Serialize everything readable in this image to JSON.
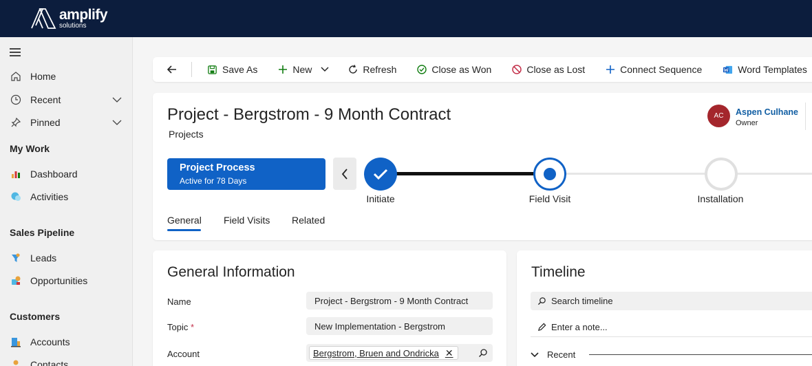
{
  "brand": {
    "name": "amplify",
    "tagline": "solutions"
  },
  "sidebar": {
    "items": [
      {
        "label": "Home"
      },
      {
        "label": "Recent"
      },
      {
        "label": "Pinned"
      }
    ],
    "sections": [
      {
        "title": "My Work",
        "items": [
          {
            "label": "Dashboard"
          },
          {
            "label": "Activities"
          }
        ]
      },
      {
        "title": "Sales Pipeline",
        "items": [
          {
            "label": "Leads"
          },
          {
            "label": "Opportunities"
          }
        ]
      },
      {
        "title": "Customers",
        "items": [
          {
            "label": "Accounts"
          },
          {
            "label": "Contacts"
          }
        ]
      }
    ]
  },
  "commandbar": {
    "save_as": "Save As",
    "new": "New",
    "refresh": "Refresh",
    "close_won": "Close as Won",
    "close_lost": "Close as Lost",
    "connect_sequence": "Connect Sequence",
    "word_templates": "Word Templates"
  },
  "record": {
    "title": "Project - Bergstrom - 9 Month Contract",
    "entity": "Projects",
    "owner": {
      "initials": "AC",
      "name": "Aspen Culhane",
      "role": "Owner"
    }
  },
  "process": {
    "name": "Project Process",
    "status": "Active for 78 Days",
    "stages": [
      {
        "label": "Initiate",
        "state": "complete"
      },
      {
        "label": "Field Visit",
        "state": "active"
      },
      {
        "label": "Installation",
        "state": "pending"
      }
    ]
  },
  "tabs": [
    {
      "label": "General",
      "selected": true
    },
    {
      "label": "Field Visits"
    },
    {
      "label": "Related"
    }
  ],
  "general": {
    "title": "General Information",
    "fields": {
      "name": {
        "label": "Name",
        "value": "Project - Bergstrom - 9 Month Contract"
      },
      "topic": {
        "label": "Topic",
        "required_mark": "*",
        "value": "New Implementation - Bergstrom"
      },
      "account": {
        "label": "Account",
        "value": "Bergstrom, Bruen and Ondricka"
      }
    }
  },
  "timeline": {
    "title": "Timeline",
    "search_placeholder": "Search timeline",
    "note_placeholder": "Enter a note...",
    "group": "Recent"
  },
  "colors": {
    "topbar": "#0c1d3d",
    "accent": "#1062c6",
    "avatar": "#a4262c"
  }
}
